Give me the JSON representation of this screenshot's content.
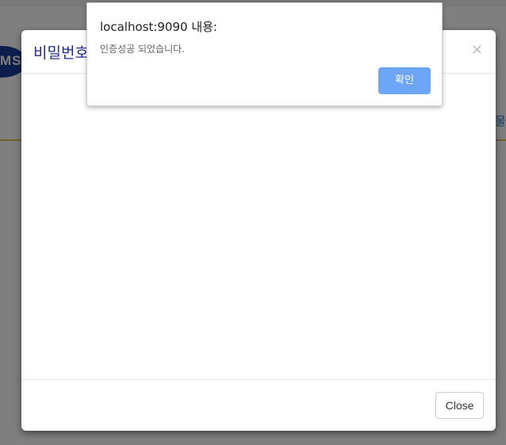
{
  "background_page": {
    "logo_text": "MS",
    "right_menu_text": "물"
  },
  "modal": {
    "title": "비밀번호",
    "close_symbol": "×",
    "close_button_label": "Close"
  },
  "alert": {
    "title": "localhost:9090 내용:",
    "message": "인증성공 되었습니다.",
    "ok_label": "확인"
  },
  "colors": {
    "modal_title": "#1f2d8f",
    "alert_button": "#6ea6f7",
    "header_accent": "#e0c14a",
    "logo_blue": "#1b3d9a"
  }
}
